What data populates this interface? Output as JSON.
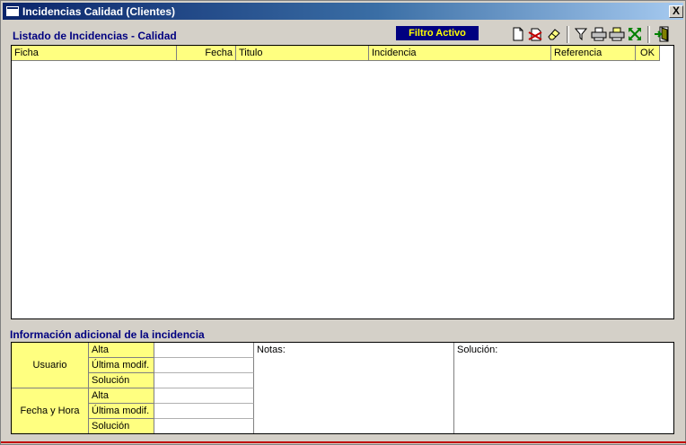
{
  "window": {
    "title": "Incidencias Calidad (Clientes)",
    "close_label": "X"
  },
  "list": {
    "title": "Listado de Incidencias - Calidad",
    "filter_badge": "Filtro Activo",
    "columns": [
      "Ficha",
      "Fecha",
      "Titulo",
      "Incidencia",
      "Referencia",
      "OK"
    ],
    "rows": []
  },
  "toolbar": {
    "icons": [
      "new-document-icon",
      "delete-icon",
      "eraser-icon",
      "filter-icon",
      "print-icon",
      "print-preview-icon",
      "expand-icon",
      "exit-icon"
    ]
  },
  "info": {
    "title": "Información adicional de la incidencia",
    "groups": [
      {
        "label": "Usuario",
        "rows": [
          "Alta",
          "Última modif.",
          "Solución"
        ],
        "values": [
          "",
          "",
          ""
        ]
      },
      {
        "label": "Fecha y Hora",
        "rows": [
          "Alta",
          "Última modif.",
          "Solución"
        ],
        "values": [
          "",
          "",
          ""
        ]
      }
    ],
    "notes_label": "Notas:",
    "notes_value": "",
    "solution_label": "Solución:",
    "solution_value": ""
  },
  "colors": {
    "title_bar": "#0a246a",
    "header_yellow": "#ffff80",
    "section_title": "#000080",
    "filter_badge_bg": "#000080",
    "filter_badge_text": "#ffff00"
  }
}
